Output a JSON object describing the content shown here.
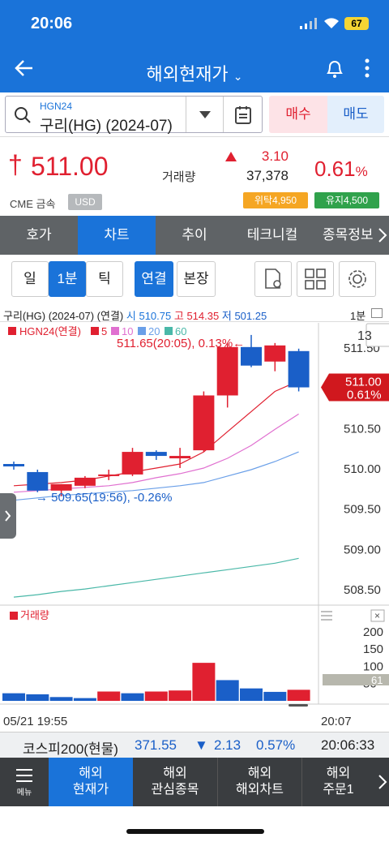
{
  "status": {
    "time": "20:06",
    "battery": "67"
  },
  "header": {
    "title": "해외현재가"
  },
  "search": {
    "code": "HGN24",
    "name": "구리(HG) (2024-07)"
  },
  "actions": {
    "buy": "매수",
    "sell": "매도"
  },
  "quote": {
    "price": "511.00",
    "exchange": "CME 금속",
    "currency": "USD",
    "volume_label": "거래량",
    "change": "3.10",
    "volume": "37,378",
    "change_pct": "0.61",
    "pct_sign": "%",
    "margin_consign": "위탁4,950",
    "margin_maintain": "유지4,500"
  },
  "tabs": [
    "호가",
    "차트",
    "추이",
    "테크니컬",
    "종목정보"
  ],
  "chart_toolbar": {
    "day": "일",
    "min": "1분",
    "tick": "틱",
    "linked": "연결",
    "main": "본장"
  },
  "chart_info": {
    "name": "구리(HG) (2024-07) (연결)",
    "open_label": "시",
    "open": "510.75",
    "high_label": "고",
    "high": "514.35",
    "low_label": "저",
    "low": "501.25",
    "period": "1분"
  },
  "legend": {
    "symbol": "HGN24(연결)",
    "ma5": "5",
    "ma10": "10",
    "ma20": "20",
    "ma60": "60"
  },
  "zoom": "13",
  "annotations": {
    "high": "511.65(20:05), 0.13%",
    "low": "509.65(19:56), -0.26%"
  },
  "price_tag": {
    "price": "511.00",
    "pct": "0.61%"
  },
  "volume_title": "거래량",
  "volume_tag": "61",
  "time_axis": {
    "start": "05/21 19:55",
    "end": "20:07"
  },
  "chart_data": {
    "type": "candlestick",
    "price_axis": {
      "ticks": [
        "511.50",
        "511.00",
        "510.50",
        "510.00",
        "509.50",
        "509.00",
        "508.50"
      ],
      "ylim": [
        508.3,
        511.8
      ]
    },
    "candles": [
      {
        "open": 510.05,
        "high": 510.08,
        "low": 509.98,
        "close": 510.02
      },
      {
        "open": 509.95,
        "high": 509.98,
        "low": 509.7,
        "close": 509.72
      },
      {
        "open": 509.72,
        "high": 509.8,
        "low": 509.65,
        "close": 509.8
      },
      {
        "open": 509.78,
        "high": 509.9,
        "low": 509.75,
        "close": 509.88
      },
      {
        "open": 509.9,
        "high": 509.98,
        "low": 509.85,
        "close": 509.92
      },
      {
        "open": 509.92,
        "high": 510.25,
        "low": 509.9,
        "close": 510.2
      },
      {
        "open": 510.2,
        "high": 510.22,
        "low": 510.1,
        "close": 510.15
      },
      {
        "open": 510.12,
        "high": 510.25,
        "low": 510.0,
        "close": 510.15
      },
      {
        "open": 510.22,
        "high": 510.95,
        "low": 510.2,
        "close": 510.9
      },
      {
        "open": 510.9,
        "high": 511.55,
        "low": 510.75,
        "close": 511.5
      },
      {
        "open": 511.5,
        "high": 511.65,
        "low": 511.25,
        "close": 511.27
      },
      {
        "open": 511.32,
        "high": 511.55,
        "low": 511.2,
        "close": 511.52
      },
      {
        "open": 511.45,
        "high": 511.48,
        "low": 510.95,
        "close": 511.0
      }
    ],
    "ma": [
      {
        "period": 5,
        "values": [
          509.78,
          509.8,
          509.82,
          509.85,
          509.9,
          509.95,
          510.0,
          510.05,
          510.2,
          510.45,
          510.7,
          510.95,
          511.08
        ]
      },
      {
        "period": 10,
        "values": [
          509.7,
          509.72,
          509.74,
          509.76,
          509.78,
          509.82,
          509.88,
          509.93,
          510.0,
          510.12,
          510.28,
          510.48,
          510.67
        ]
      },
      {
        "period": 20,
        "values": [
          509.6,
          509.63,
          509.66,
          509.68,
          509.7,
          509.72,
          509.75,
          509.78,
          509.82,
          509.9,
          509.98,
          510.08,
          510.2
        ]
      },
      {
        "period": 60,
        "values": [
          508.4,
          508.43,
          508.47,
          508.5,
          508.54,
          508.58,
          508.62,
          508.66,
          508.7,
          508.74,
          508.78,
          508.82,
          508.88
        ]
      }
    ],
    "volume_axis": {
      "ticks": [
        "200",
        "150",
        "100",
        "50"
      ],
      "ylim": [
        0,
        230
      ]
    },
    "volume": [
      {
        "v": 22,
        "up": false
      },
      {
        "v": 19,
        "up": false
      },
      {
        "v": 11,
        "up": false
      },
      {
        "v": 8,
        "up": false
      },
      {
        "v": 27,
        "up": true
      },
      {
        "v": 22,
        "up": false
      },
      {
        "v": 27,
        "up": true
      },
      {
        "v": 30,
        "up": true
      },
      {
        "v": 110,
        "up": true
      },
      {
        "v": 60,
        "up": false
      },
      {
        "v": 36,
        "up": false
      },
      {
        "v": 26,
        "up": false
      },
      {
        "v": 32,
        "up": true
      }
    ]
  },
  "ticker": {
    "name": "코스피200(현물)",
    "value": "371.55",
    "change": "2.13",
    "pct": "0.57%",
    "time": "20:06:33"
  },
  "nav": {
    "menu": "메뉴",
    "items": [
      [
        "해외",
        "현재가"
      ],
      [
        "해외",
        "관심종목"
      ],
      [
        "해외",
        "해외차트"
      ],
      [
        "해외",
        "주문1"
      ]
    ]
  },
  "colors": {
    "primary": "#1a73d9",
    "up": "#e02030",
    "down": "#1a5fc8"
  }
}
